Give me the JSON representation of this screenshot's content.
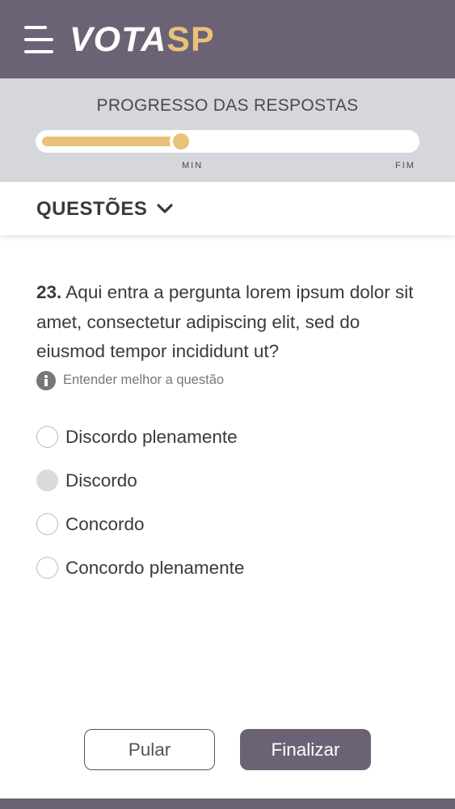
{
  "header": {
    "logo_part1": "VOTA",
    "logo_part2": "SP",
    "menu_icon": "hamburger-icon",
    "colors": {
      "bar": "#6b6275",
      "accent": "#e9c27a"
    }
  },
  "progress": {
    "title": "PROGRESSO DAS RESPOSTAS",
    "min_label": "MIN",
    "end_label": "FIM",
    "value": 0.41
  },
  "questions_nav": {
    "label": "QUESTÕES",
    "icon": "chevron-down-icon"
  },
  "question": {
    "number": "23.",
    "text": "Aqui entra a pergunta lorem ipsum dolor sit amet, consectetur adipiscing elit, sed do eiusmod tempor incididunt ut?",
    "hint": "Entender melhor a questão",
    "hint_icon": "info-icon"
  },
  "options": [
    {
      "label": "Discordo plenamente",
      "selected": false
    },
    {
      "label": "Discordo",
      "selected": true
    },
    {
      "label": "Concordo",
      "selected": false
    },
    {
      "label": "Concordo plenamente",
      "selected": false
    }
  ],
  "actions": {
    "skip_label": "Pular",
    "finish_label": "Finalizar"
  }
}
